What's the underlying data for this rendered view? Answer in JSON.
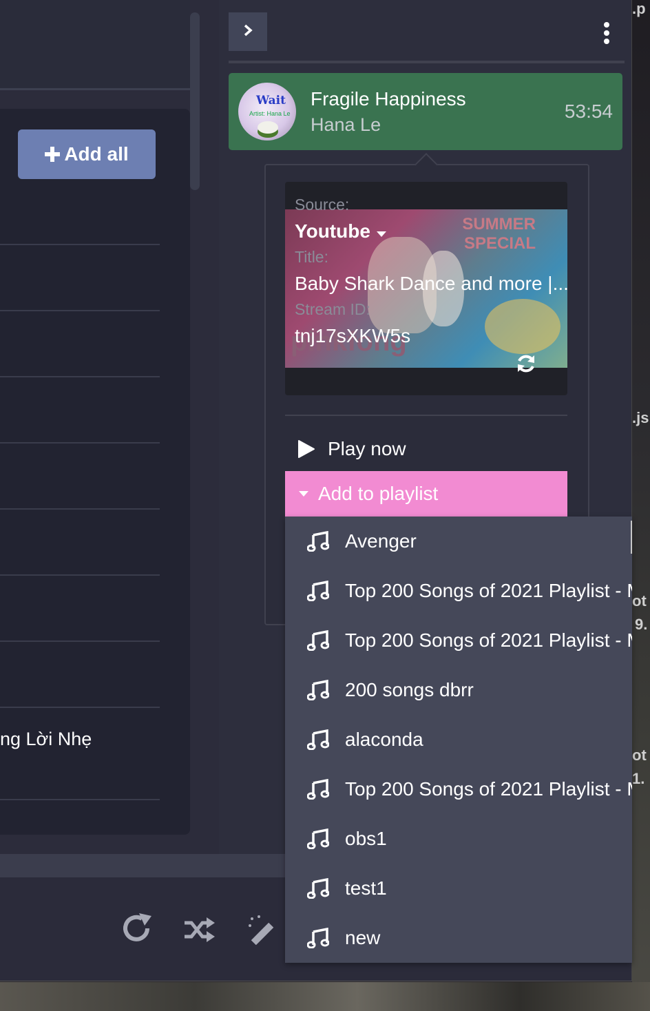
{
  "left_panel": {
    "add_all_label": "Add all",
    "visible_song_text": "ng Lời Nhẹ"
  },
  "now_playing": {
    "title": "Fragile Happiness",
    "artist": "Hana Le",
    "duration": "53:54",
    "thumbnail_text": "Wait",
    "thumbnail_subtext": "Artist: Hana Le"
  },
  "details": {
    "source_label": "Source:",
    "source_value": "Youtube",
    "title_label": "Title:",
    "title_value": "Baby Shark Dance and more |...",
    "stream_label": "Stream ID:",
    "stream_value": "tnj17sXKW5s",
    "thumbnail_text_1": "SUMMER",
    "thumbnail_text_2": "SPECIAL",
    "thumbnail_text_3": "pinkfong"
  },
  "actions": {
    "play_now": "Play now",
    "add_to_playlist": "Add to playlist"
  },
  "playlists": [
    "Avenger",
    "Top 200 Songs of 2021 Playlist - M",
    "Top 200 Songs of 2021 Playlist - M",
    "200 songs dbrr",
    "alaconda",
    "Top 200 Songs of 2021 Playlist - M",
    "obs1",
    "test1",
    "new"
  ],
  "background_text": [
    ".p",
    ".js",
    "ot",
    "9.",
    "ot",
    "1."
  ],
  "colors": {
    "now_playing_bg": "#3a7350",
    "add_all_bg": "#6d7fb2",
    "add_to_playlist_bg": "#f28bd2",
    "menu_bg": "#454859"
  },
  "icons": [
    "chevron-right-icon",
    "more-vertical-icon",
    "caret-down-icon",
    "refresh-icon",
    "play-icon",
    "music-note-icon",
    "redo-icon",
    "shuffle-icon",
    "magic-wand-icon",
    "plus-icon"
  ]
}
